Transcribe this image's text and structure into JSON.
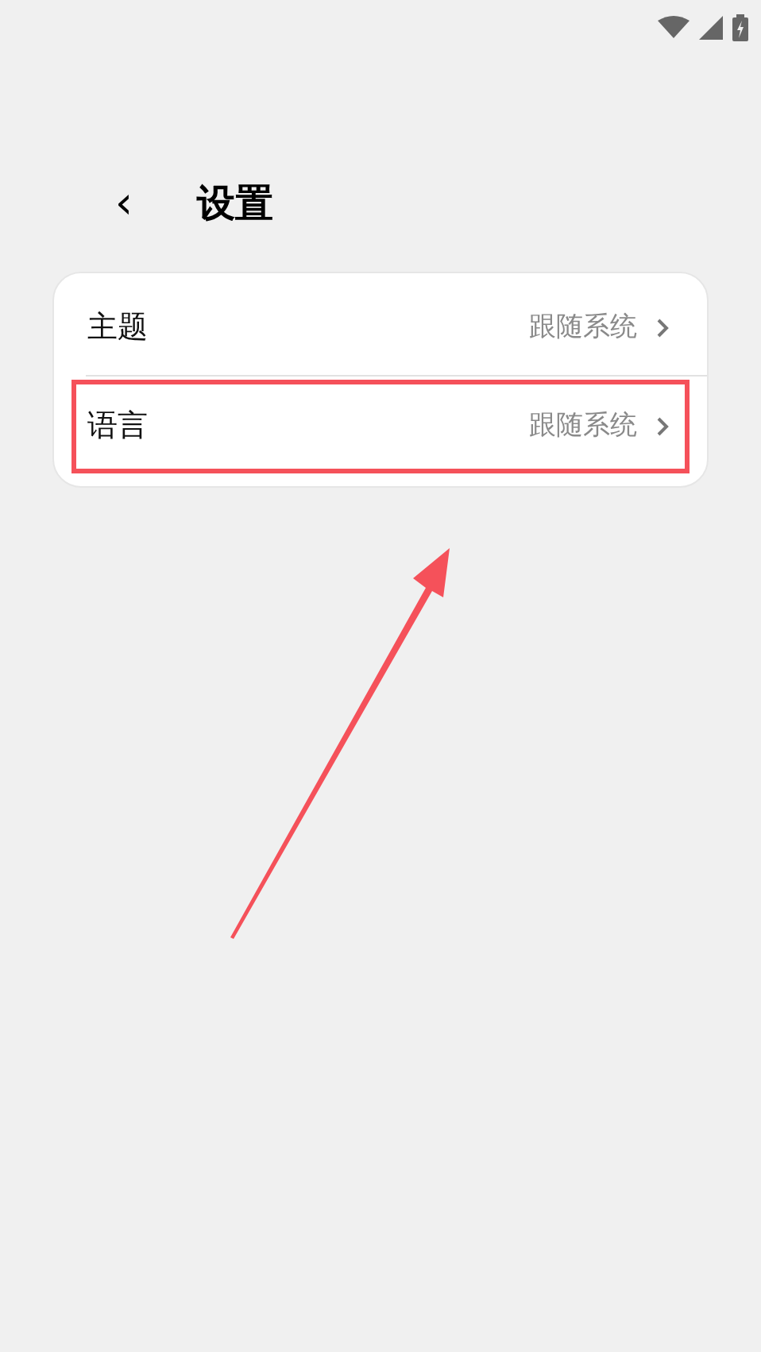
{
  "header": {
    "back": "‹",
    "title": "设置"
  },
  "settings": [
    {
      "label": "主题",
      "value": "跟随系统",
      "highlighted": false
    },
    {
      "label": "语言",
      "value": "跟随系统",
      "highlighted": true
    }
  ]
}
